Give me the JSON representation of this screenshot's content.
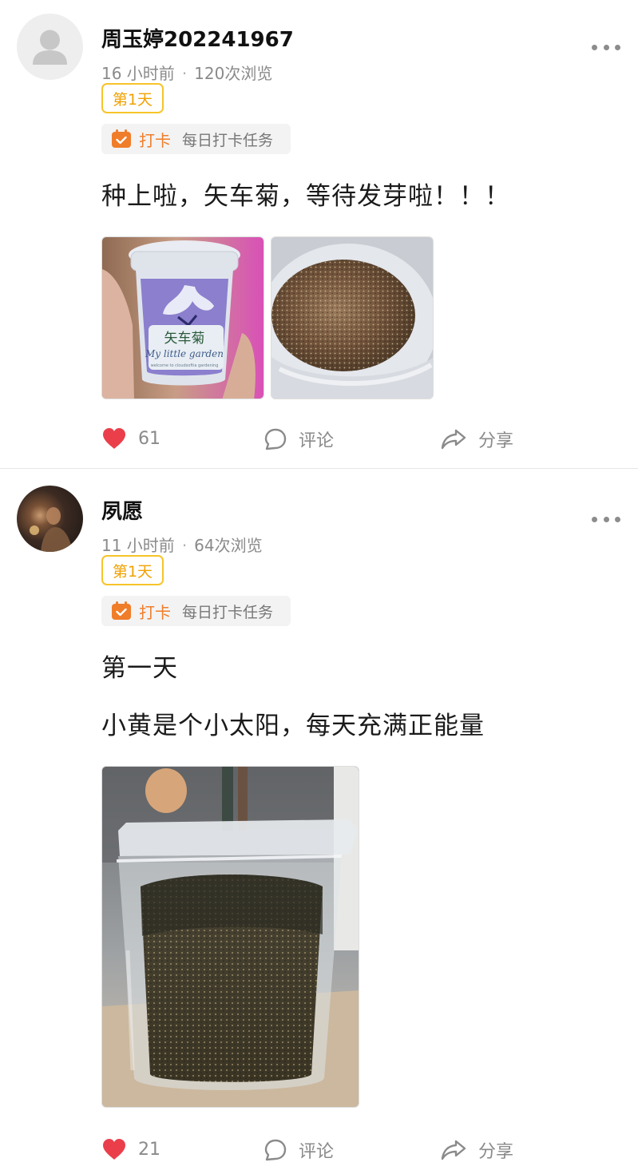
{
  "posts": [
    {
      "username": "周玉婷202241967",
      "time": "16 小时前",
      "views": "120次浏览",
      "day_badge": "第1天",
      "checkin_label": "打卡",
      "checkin_task": "每日打卡任务",
      "paragraphs": [
        "种上啦，矢车菊，等待发芽啦！！！"
      ],
      "image_texts": [
        "矢车菊",
        "My little garden",
        "welcome to cloudsoftia gardening"
      ],
      "likes": "61",
      "comment_label": "评论",
      "share_label": "分享"
    },
    {
      "username": "夙愿",
      "time": "11 小时前",
      "views": "64次浏览",
      "day_badge": "第1天",
      "checkin_label": "打卡",
      "checkin_task": "每日打卡任务",
      "paragraphs": [
        "第一天",
        "小黄是个小太阳，每天充满正能量"
      ],
      "likes": "21",
      "comment_label": "评论",
      "share_label": "分享"
    }
  ],
  "colors": {
    "badge_border": "#f6c42a",
    "badge_text": "#f0a100",
    "checkin_orange": "#f07d2a",
    "like_red": "#ea3f4b",
    "muted_text": "#8a8a8a"
  },
  "icons": [
    "default-avatar-icon",
    "more-icon",
    "calendar-check-icon",
    "heart-icon",
    "comment-icon",
    "share-icon"
  ]
}
